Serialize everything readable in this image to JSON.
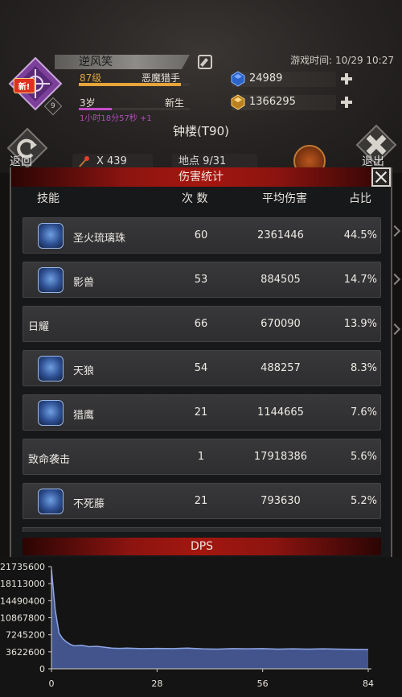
{
  "header": {
    "player_name": "逆风笑",
    "level": "87级",
    "class_name": "恶魔猎手",
    "xp_fraction": 0.92,
    "age": "3岁",
    "stage": "新生",
    "age_fraction": 0.3,
    "timer": "1小时18分57秒 +1",
    "emblem_badge": "新!",
    "emblem_level": "9",
    "game_time": "游戏时间: 10/29 10:27",
    "gems": "24989",
    "gold": "1366295",
    "location_title": "钟楼(T90)",
    "back_label": "返回",
    "exit_label": "退出",
    "kills": "X 439",
    "location": "地点 9/31"
  },
  "damage_panel": {
    "title": "伤害统计",
    "columns": {
      "skill": "技能",
      "count": "次 数",
      "avg": "平均伤害",
      "pct": "占比"
    },
    "rows": [
      {
        "name": "圣火琉璃珠",
        "count": "60",
        "avg": "2361446",
        "pct": "44.5%",
        "icon": "fire-orb-icon"
      },
      {
        "name": "影兽",
        "count": "53",
        "avg": "884505",
        "pct": "14.7%",
        "icon": "shadow-beast-icon"
      },
      {
        "name": "日耀",
        "count": "66",
        "avg": "670090",
        "pct": "13.9%",
        "icon": ""
      },
      {
        "name": "天狼",
        "count": "54",
        "avg": "488257",
        "pct": "8.3%",
        "icon": "wolf-fang-icon"
      },
      {
        "name": "猎鹰",
        "count": "21",
        "avg": "1144665",
        "pct": "7.6%",
        "icon": "falcon-icon"
      },
      {
        "name": "致命袭击",
        "count": "1",
        "avg": "17918386",
        "pct": "5.6%",
        "icon": ""
      },
      {
        "name": "不死藤",
        "count": "21",
        "avg": "793630",
        "pct": "5.2%",
        "icon": "undead-vine-icon"
      }
    ]
  },
  "chart_data": {
    "type": "area",
    "title": "DPS",
    "xlabel": "",
    "ylabel": "",
    "xlim": [
      0,
      84
    ],
    "ylim": [
      0,
      21735600
    ],
    "x_ticks": [
      "0",
      "28",
      "56",
      "84"
    ],
    "y_ticks": [
      "21735600",
      "18113000",
      "14490400",
      "10867800",
      "7245200",
      "3622600",
      "0"
    ],
    "grid": false,
    "series": [
      {
        "color": "#4a5fa0",
        "x": [
          0,
          1,
          2,
          3,
          4,
          5,
          6,
          8,
          10,
          12,
          14,
          16,
          18,
          20,
          24,
          28,
          32,
          36,
          40,
          44,
          48,
          52,
          56,
          60,
          64,
          68,
          72,
          76,
          80,
          84
        ],
        "values": [
          21100000,
          12500000,
          7600000,
          6400000,
          5700000,
          5200000,
          4900000,
          5000000,
          4700000,
          4800000,
          4600000,
          4400000,
          4350000,
          4400000,
          4300000,
          4350000,
          4300000,
          4400000,
          4250000,
          4200000,
          4300000,
          4250000,
          4300000,
          4200000,
          4250000,
          4200000,
          4250000,
          4200000,
          4150000,
          4100000
        ]
      }
    ]
  }
}
